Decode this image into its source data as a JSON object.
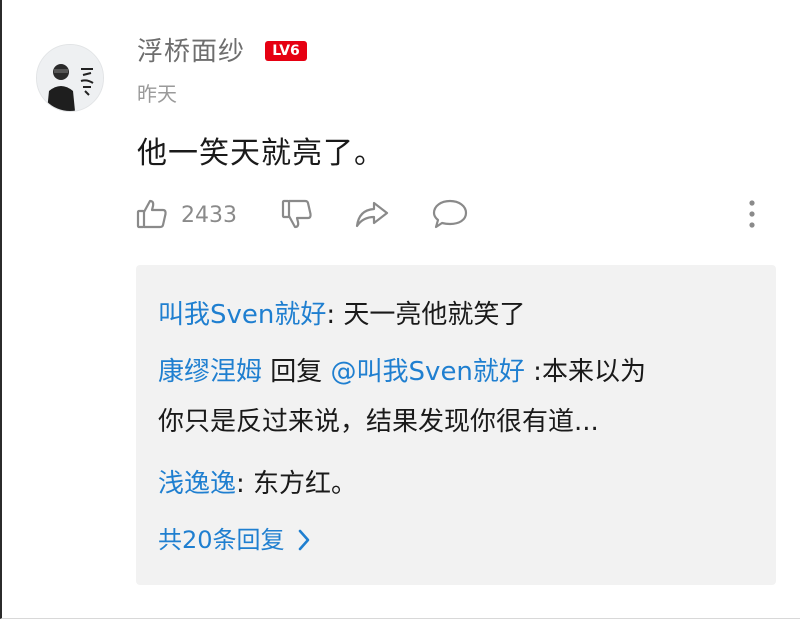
{
  "comment": {
    "username": "浮桥面纱",
    "level_badge": "LV6",
    "time": "昨天",
    "text": "他一笑天就亮了。",
    "avatar_icon": "user-avatar-icon"
  },
  "actions": {
    "like_count": "2433",
    "like_icon": "thumbs-up-icon",
    "dislike_icon": "thumbs-down-icon",
    "share_icon": "share-icon",
    "reply_icon": "comment-bubble-icon",
    "more_icon": "more-vertical-icon"
  },
  "replies": {
    "items": [
      {
        "user": "叫我Sven就好",
        "sep": ": ",
        "text": "天一亮他就笑了"
      },
      {
        "user": "康缪涅姆",
        "reply_word": " 回复 ",
        "mention": "@叫我Sven就好",
        "text_line1": " :本来以为",
        "text_line2": "你只是反过来说，结果发现你很有道..."
      },
      {
        "user": "浅逸逸",
        "sep": ": ",
        "text": "东方红。"
      }
    ],
    "more_label": "共20条回复",
    "more_icon": "chevron-right-icon"
  },
  "colors": {
    "link_blue": "#1f7fd0",
    "badge_red": "#e60012",
    "reply_bg": "#f2f2f2"
  }
}
